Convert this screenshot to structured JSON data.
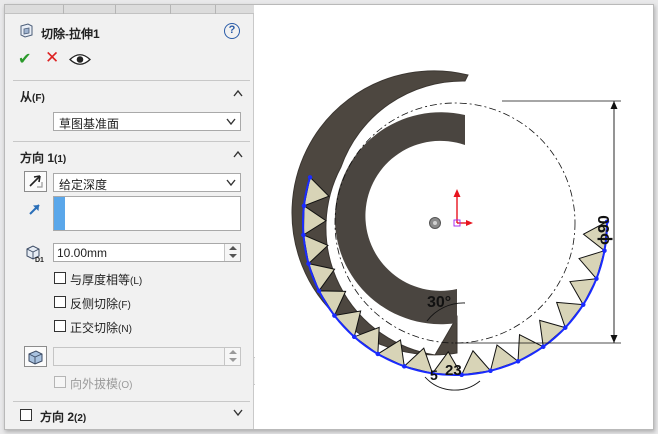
{
  "feature": {
    "title": "切除-拉伸1",
    "help": "?"
  },
  "from": {
    "label": "从",
    "shortcut": "(F)",
    "value": "草图基准面"
  },
  "direction1": {
    "label": "方向 1",
    "shortcut": "(1)",
    "end_condition": "给定深度",
    "depth": "10.00mm",
    "option_flip_side": "与厚度相等",
    "option_flip_side_shortcut": "(L)",
    "option_reverse_cut": "反侧切除",
    "option_reverse_cut_shortcut": "(F)",
    "option_normal_cut": "正交切除",
    "option_normal_cut_shortcut": "(N)",
    "draft_outward": "向外拔模",
    "draft_outward_shortcut": "(O)"
  },
  "direction2": {
    "label": "方向 2",
    "shortcut": "(2)"
  },
  "graphics": {
    "diameter_label": "ϕ90",
    "angle_label": "30°",
    "small_dim_label": "23",
    "small_dim_label_2": "5",
    "colors": {
      "part": "#4d4740",
      "tooth_fill": "#d8d4b7",
      "sketch_blue": "#1a2bff",
      "axis_red": "#e8141e"
    }
  },
  "icons": [
    "feature-cut-icon",
    "help-icon",
    "ok-check-icon",
    "cancel-x-icon",
    "preview-eye-icon",
    "direction-arrow-icon",
    "reverse-direction-icon",
    "depth-icon",
    "draft-body-icon"
  ]
}
